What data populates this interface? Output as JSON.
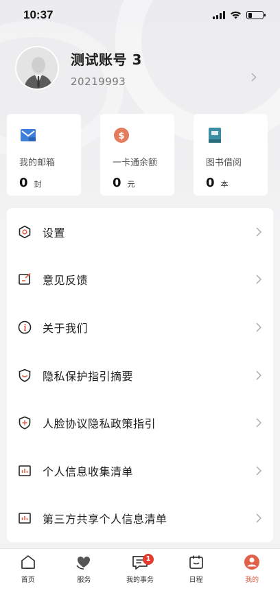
{
  "status_bar": {
    "time": "10:37"
  },
  "profile": {
    "name": "测试账号 3",
    "id": "20219993"
  },
  "stats": [
    {
      "icon": "mail-icon",
      "label": "我的邮箱",
      "value": "0",
      "unit": "封",
      "color": "#3e7fd9"
    },
    {
      "icon": "dollar-coin-icon",
      "label": "一卡通余额",
      "value": "0",
      "unit": "元",
      "color": "#e37b5d"
    },
    {
      "icon": "book-icon",
      "label": "图书借阅",
      "value": "0",
      "unit": "本",
      "color": "#3b8ea3"
    }
  ],
  "menu": [
    {
      "icon": "settings-icon",
      "label": "设置"
    },
    {
      "icon": "feedback-icon",
      "label": "意见反馈"
    },
    {
      "icon": "info-icon",
      "label": "关于我们"
    },
    {
      "icon": "privacy-shield-icon",
      "label": "隐私保护指引摘要"
    },
    {
      "icon": "face-shield-icon",
      "label": "人脸协议隐私政策指引"
    },
    {
      "icon": "chart-list-icon",
      "label": "个人信息收集清单"
    },
    {
      "icon": "chart-list-icon",
      "label": "第三方共享个人信息清单"
    }
  ],
  "tabs": [
    {
      "icon": "home-icon",
      "label": "首页",
      "active": false
    },
    {
      "icon": "service-heart-icon",
      "label": "服务",
      "active": false
    },
    {
      "icon": "message-icon",
      "label": "我的事务",
      "active": false,
      "badge": "1"
    },
    {
      "icon": "calendar-icon",
      "label": "日程",
      "active": false
    },
    {
      "icon": "user-icon",
      "label": "我的",
      "active": true
    }
  ],
  "colors": {
    "accent": "#e2614a",
    "icon_orange": "#e2614a",
    "badge": "#e23b2e"
  }
}
